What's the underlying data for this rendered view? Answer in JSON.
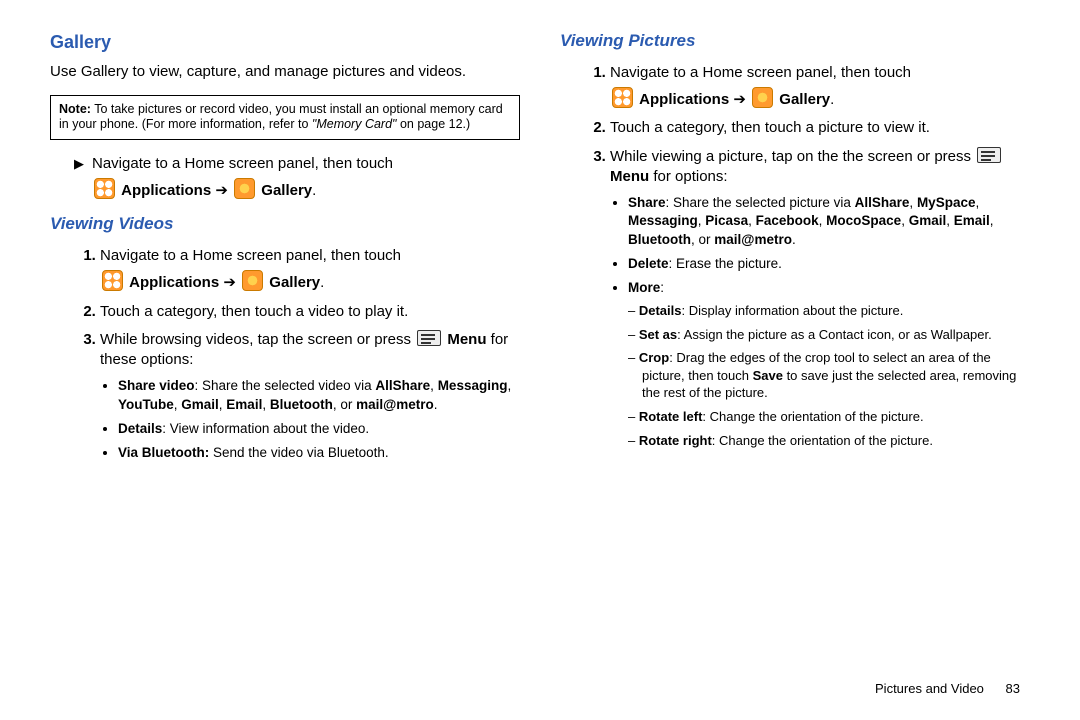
{
  "left": {
    "heading": "Gallery",
    "intro": "Use Gallery to view, capture, and manage pictures and videos.",
    "note_label": "Note:",
    "note_body_a": "To take pictures or record video, you must install an optional memory card in your phone. (For more information, refer to ",
    "note_body_mem": "\"Memory Card\"",
    "note_body_b": " on page 12.)",
    "nav_text": "Navigate to a Home screen panel, then touch",
    "path_apps": "Applications",
    "path_arrow": "➔",
    "path_gallery": "Gallery",
    "sub_videos": "Viewing Videos",
    "v_step1": "Navigate to a Home screen panel, then touch",
    "v_step2": "Touch a category, then touch a video to play it.",
    "v_step3a": "While browsing videos, tap the screen or press ",
    "v_step3_menu": "Menu",
    "v_step3b": " for these options:",
    "b1a": "Share video",
    "b1b": ": Share the selected video via ",
    "b1c": "AllShare",
    "b1d": "Messaging",
    "b1e": "YouTube",
    "b1f": "Gmail",
    "b1g": "Email",
    "b1h": "Bluetooth",
    "b1i": "mail@metro",
    "b2a": "Details",
    "b2b": ": View information about the video.",
    "b3a": "Via Bluetooth:",
    "b3b": " Send the video via Bluetooth."
  },
  "right": {
    "sub_pics": "Viewing Pictures",
    "p_step1": "Navigate to a Home screen panel, then touch",
    "p_step2": "Touch a category, then touch a picture to view it.",
    "p_step3a": "While viewing a picture, tap on the the screen or press ",
    "p_step3_menu": "Menu",
    "p_step3b": "  for options:",
    "s1a": "Share",
    "s1b": ": Share the selected picture via ",
    "s1_all": "AllShare",
    "s1_my": "MySpace",
    "s1_msg": "Messaging",
    "s1_pic": "Picasa",
    "s1_fb": "Facebook",
    "s1_moco": "MocoSpace",
    "s1_gm": "Gmail",
    "s1_em": "Email",
    "s1_bt": "Bluetooth",
    "s1_mm": "mail@metro",
    "s2a": "Delete",
    "s2b": ": Erase the picture.",
    "s3a": "More",
    "d1a": "Details",
    "d1b": ": Display information about the picture.",
    "d2a": "Set as",
    "d2b": ": Assign the picture as a Contact icon, or as Wallpaper.",
    "d3a": "Crop",
    "d3b": ": Drag the edges of the crop tool to select an area of the picture, then touch ",
    "d3save": "Save",
    "d3c": " to save just the selected area, removing the rest of the picture.",
    "d4a": "Rotate left",
    "d4b": ": Change the orientation of the picture.",
    "d5a": "Rotate right",
    "d5b": ": Change the orientation of the picture."
  },
  "footer": {
    "section": "Pictures and Video",
    "page": "83"
  }
}
